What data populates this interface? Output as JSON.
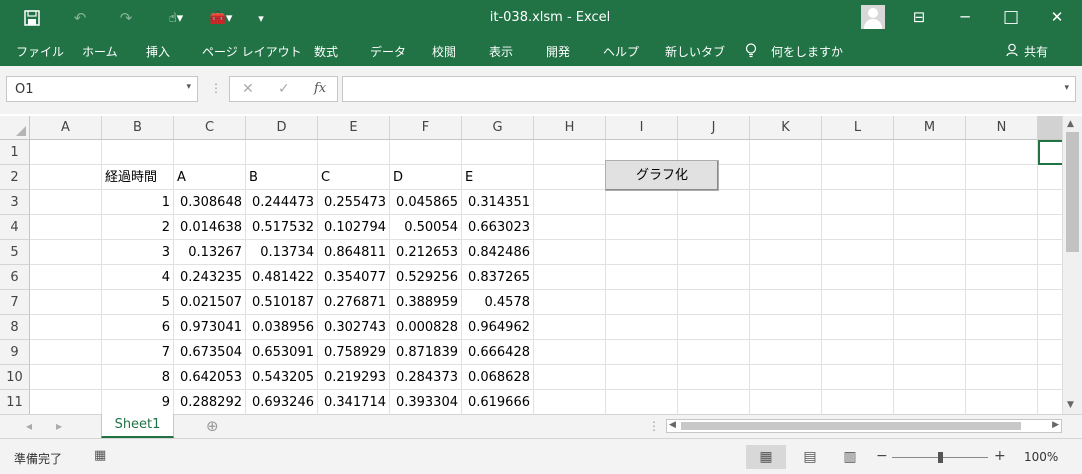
{
  "window": {
    "title": "it-038.xlsm  -  Excel",
    "minimize_glyph": "─",
    "restore_glyph": "□",
    "close_glyph": "✕",
    "ribbon_display_glyph": "⊟"
  },
  "quick_access": {
    "save_icon": "💾",
    "undo_icon": "↶",
    "redo_icon": "↷",
    "touch_icon": "☝▾",
    "tools_icon": "🧰▾",
    "customize_icon": "▾"
  },
  "ribbon": {
    "tabs": [
      "ファイル",
      "ホーム",
      "挿入",
      "ページ レイアウト",
      "数式",
      "データ",
      "校閲",
      "表示",
      "開発",
      "ヘルプ",
      "新しいタブ"
    ],
    "tell_me": "何をしますか",
    "tell_me_icon": "💡",
    "share": "共有",
    "share_icon": "👤"
  },
  "formula_bar": {
    "name_box": "O1",
    "cancel": "✕",
    "enter": "✓",
    "fx": "fx",
    "dd": "▾",
    "dots": "⋮",
    "formula": ""
  },
  "grid": {
    "columns": [
      "A",
      "B",
      "C",
      "D",
      "E",
      "F",
      "G",
      "H",
      "I",
      "J",
      "K",
      "L",
      "M",
      "N"
    ],
    "rows": [
      "1",
      "2",
      "3",
      "4",
      "5",
      "6",
      "7",
      "8",
      "9",
      "10",
      "11"
    ],
    "header_row": [
      "経過時間",
      "A",
      "B",
      "C",
      "D",
      "E"
    ],
    "data": [
      [
        "1",
        "0.308648",
        "0.244473",
        "0.255473",
        "0.045865",
        "0.314351"
      ],
      [
        "2",
        "0.014638",
        "0.517532",
        "0.102794",
        "0.50054",
        "0.663023"
      ],
      [
        "3",
        "0.13267",
        "0.13734",
        "0.864811",
        "0.212653",
        "0.842486"
      ],
      [
        "4",
        "0.243235",
        "0.481422",
        "0.354077",
        "0.529256",
        "0.837265"
      ],
      [
        "5",
        "0.021507",
        "0.510187",
        "0.276871",
        "0.388959",
        "0.4578"
      ],
      [
        "6",
        "0.973041",
        "0.038956",
        "0.302743",
        "0.000828",
        "0.964962"
      ],
      [
        "7",
        "0.673504",
        "0.653091",
        "0.758929",
        "0.871839",
        "0.666428"
      ],
      [
        "8",
        "0.642053",
        "0.543205",
        "0.219293",
        "0.284373",
        "0.068628"
      ],
      [
        "9",
        "0.288292",
        "0.693246",
        "0.341714",
        "0.393304",
        "0.619666"
      ]
    ],
    "button_label": "グラフ化"
  },
  "sheets": {
    "active": "Sheet1",
    "add_icon": "⊕",
    "prev": "◂",
    "next": "▸"
  },
  "status": {
    "ready": "準備完了",
    "macro_icon": "▦",
    "normal_view_icon": "▦",
    "page_layout_icon": "▤",
    "page_break_icon": "▥",
    "zoom_minus": "−",
    "zoom_plus": "+",
    "zoom": "100%"
  }
}
